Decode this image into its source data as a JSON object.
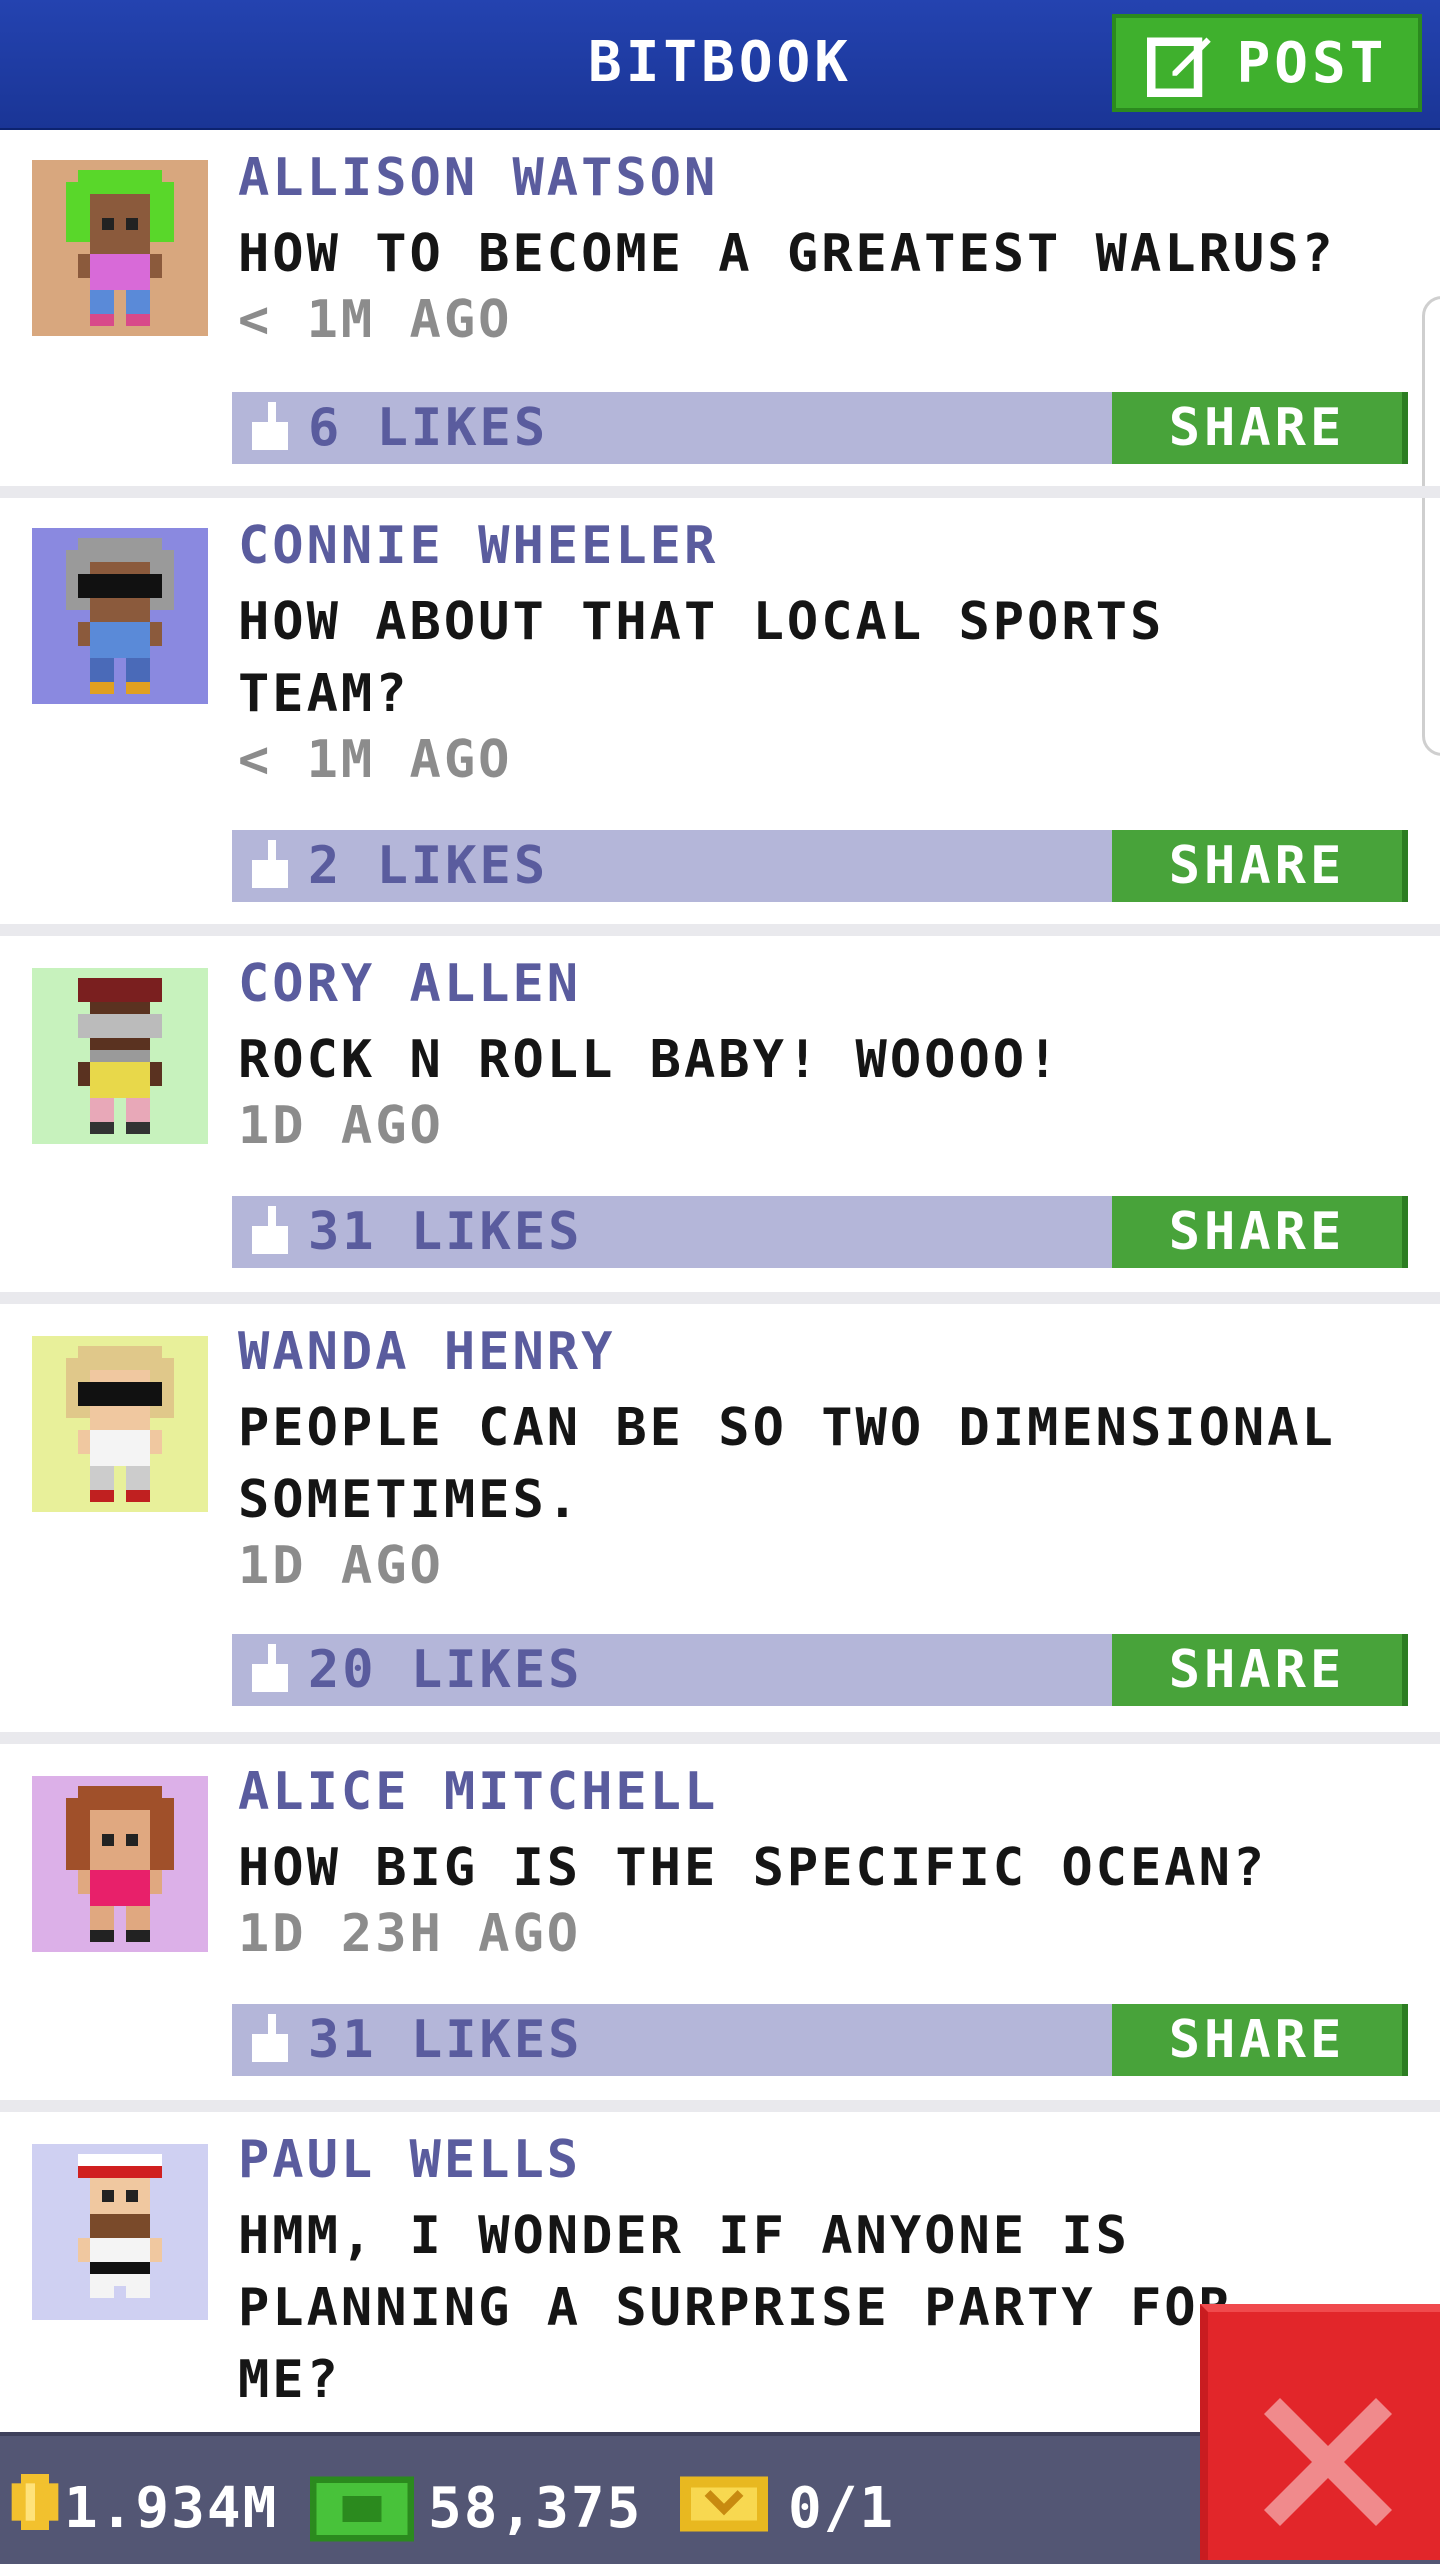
{
  "header": {
    "title": "BITBOOK",
    "post_label": "POST"
  },
  "posts": [
    {
      "name": "ALLISON WATSON",
      "lines": [
        "HOW TO BECOME A GREATEST WALRUS?"
      ],
      "time": "< 1M AGO",
      "likes": "6 LIKES",
      "share": "SHARE",
      "avatar_bg": "#d8a77e"
    },
    {
      "name": "CONNIE WHEELER",
      "lines": [
        "HOW ABOUT THAT LOCAL SPORTS",
        "TEAM?"
      ],
      "time": "< 1M AGO",
      "likes": "2 LIKES",
      "share": "SHARE",
      "avatar_bg": "#8a89e0"
    },
    {
      "name": "CORY ALLEN",
      "lines": [
        "ROCK N ROLL BABY! WOOOO!"
      ],
      "time": "1D AGO",
      "likes": "31 LIKES",
      "share": "SHARE",
      "avatar_bg": "#c7f2bd"
    },
    {
      "name": "WANDA HENRY",
      "lines": [
        "PEOPLE CAN BE SO TWO DIMENSIONAL",
        "SOMETIMES."
      ],
      "time": "1D AGO",
      "likes": "20 LIKES",
      "share": "SHARE",
      "avatar_bg": "#e8f09a"
    },
    {
      "name": "ALICE MITCHELL",
      "lines": [
        "HOW BIG IS THE SPECIFIC OCEAN?"
      ],
      "time": "1D 23H AGO",
      "likes": "31 LIKES",
      "share": "SHARE",
      "avatar_bg": "#dcb0e8"
    },
    {
      "name": "PAUL WELLS",
      "lines": [
        "HMM, I WONDER IF ANYONE IS",
        "PLANNING A SURPRISE PARTY FOR",
        "ME?"
      ],
      "avatar_bg": "#cfd0f2"
    }
  ],
  "footer": {
    "coins": "1.934M",
    "bux": "58,375",
    "tickets": "0/1"
  },
  "colors": {
    "header_blue": "#2443b0",
    "share_green": "#48a33a",
    "likebar": "#b4b6d9",
    "close_red": "#e2262a"
  }
}
